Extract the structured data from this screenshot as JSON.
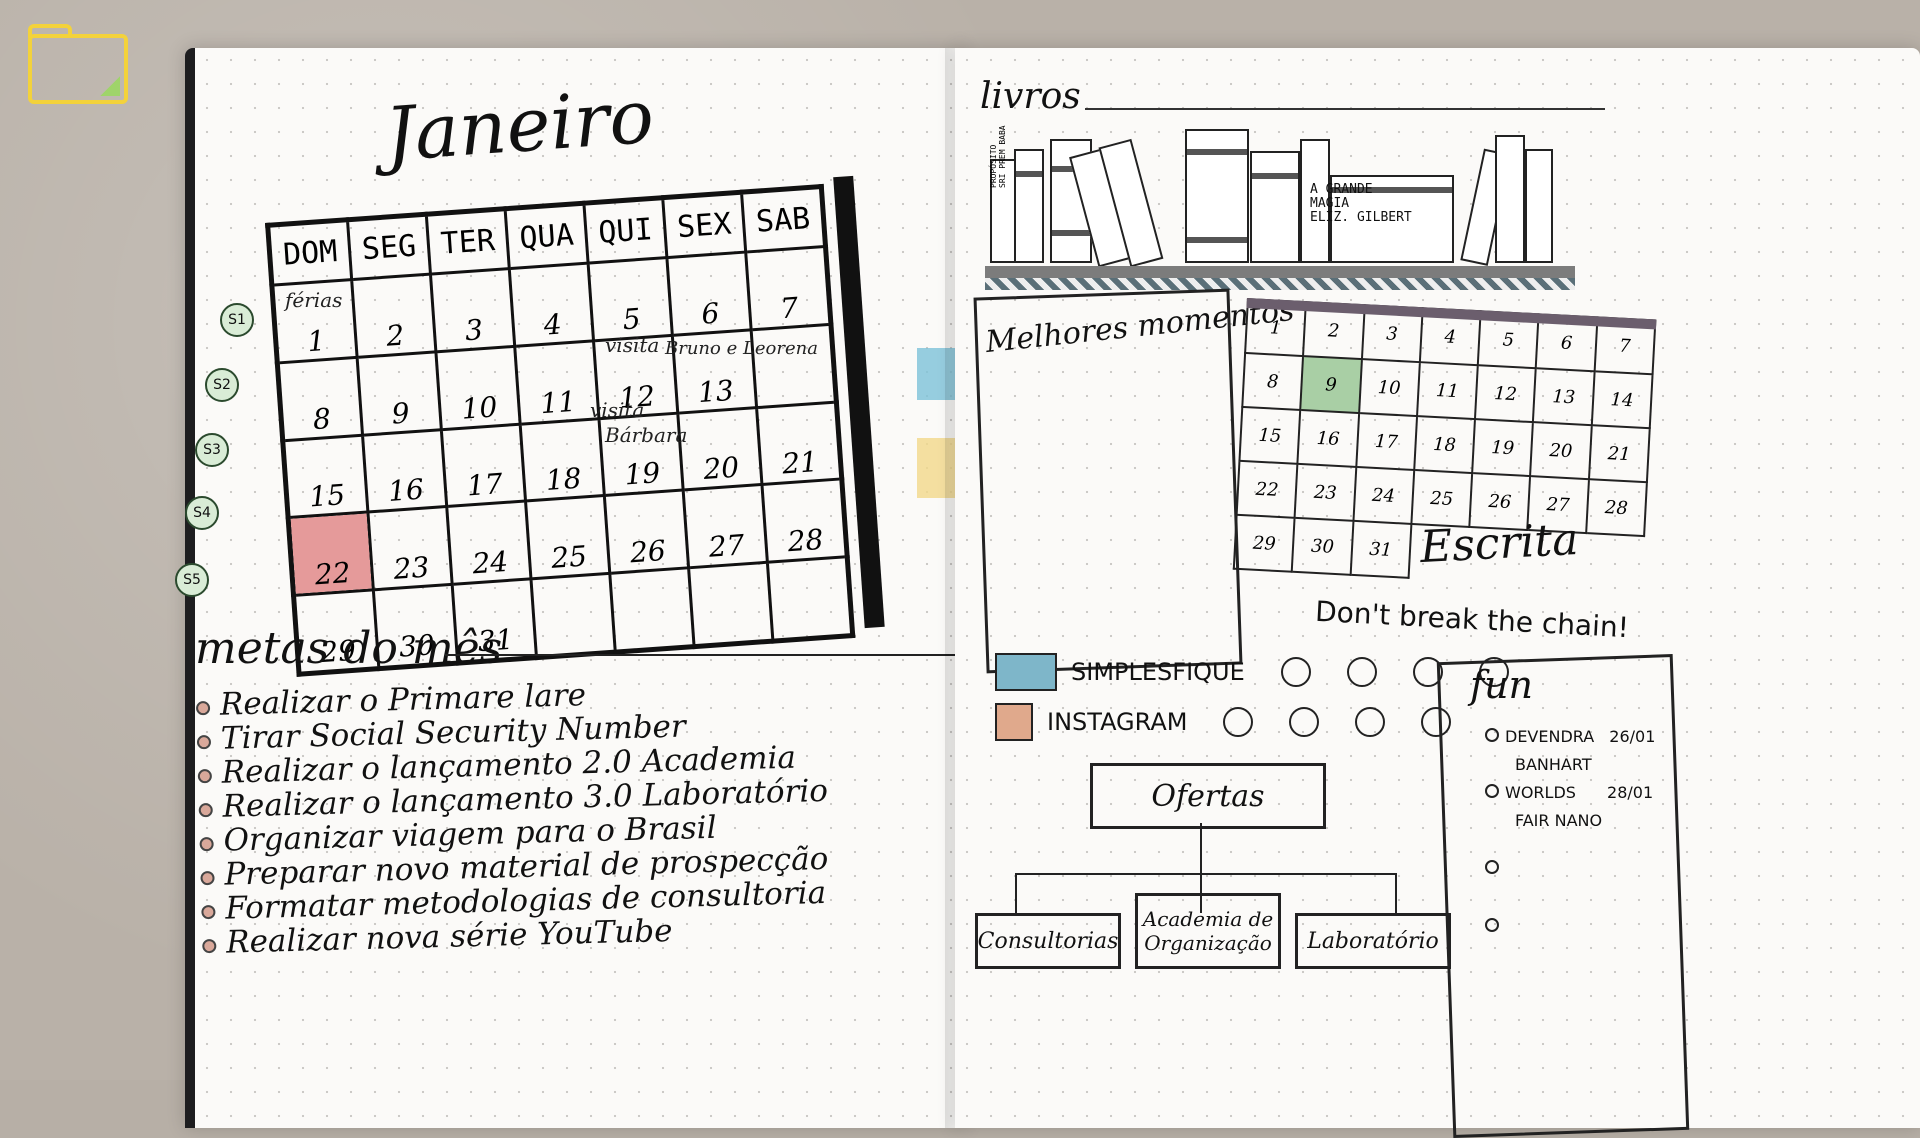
{
  "left_page": {
    "title": "Janeiro",
    "weekdays": [
      "DOM",
      "SEG",
      "TER",
      "QUA",
      "QUI",
      "SEX",
      "SAB"
    ],
    "weeks": [
      {
        "label": "S1",
        "days": [
          "1",
          "2",
          "3",
          "4",
          "5",
          "6",
          "7"
        ]
      },
      {
        "label": "S2",
        "days": [
          "8",
          "9",
          "10",
          "11",
          "12",
          "13",
          ""
        ]
      },
      {
        "label": "S3",
        "days": [
          "15",
          "16",
          "17",
          "18",
          "19",
          "20",
          "21"
        ]
      },
      {
        "label": "S4",
        "days": [
          "22",
          "23",
          "24",
          "25",
          "26",
          "27",
          "28"
        ]
      },
      {
        "label": "S5",
        "days": [
          "29",
          "30",
          "31",
          "",
          "",
          "",
          ""
        ]
      }
    ],
    "notes": {
      "ferias": "férias",
      "visita1": "visita",
      "visita1b": "Bruno e Leorena",
      "visita2": "visita",
      "visita2b": "Bárbara"
    },
    "metas_title": "metas do mês",
    "metas": [
      "Realizar o Primare lare",
      "Tirar Social Security Number",
      "Realizar o lançamento 2.0 Academia",
      "Realizar o lançamento 3.0 Laboratório",
      "Organizar viagem para o Brasil",
      "Preparar novo material de prospecção",
      "Formatar metodologias de consultoria",
      "Realizar nova série YouTube"
    ]
  },
  "right_page": {
    "livros_title": "livros",
    "book_label": "A GRANDE\nMAGIA\nELIZ. GILBERT",
    "book_spine": "PROPÓSITO\nSRI PREM BABA",
    "melhores": "Melhores momentos",
    "mini_cal_days": [
      [
        "1",
        "2",
        "3",
        "4",
        "5",
        "6",
        "7"
      ],
      [
        "8",
        "9",
        "10",
        "11",
        "12",
        "13",
        "14"
      ],
      [
        "15",
        "16",
        "17",
        "18",
        "19",
        "20",
        "21"
      ],
      [
        "22",
        "23",
        "24",
        "25",
        "26",
        "27",
        "28"
      ],
      [
        "29",
        "30",
        "31",
        "",
        "",
        "",
        ""
      ]
    ],
    "escrita": "Escrita",
    "chain": "Don't break the chain!",
    "social1": "SIMPLESFIQUE",
    "social2": "INSTAGRAM",
    "ofertas": "Ofertas",
    "sub1": "Consultorias",
    "sub2": "Academia de Organização",
    "sub3": "Laboratório",
    "fun_title": "fun",
    "fun1a": "DEVENDRA",
    "fun1b": "BANHART",
    "fun1d": "26/01",
    "fun2a": "WORLDS",
    "fun2b": "FAIR NANO",
    "fun2d": "28/01"
  }
}
